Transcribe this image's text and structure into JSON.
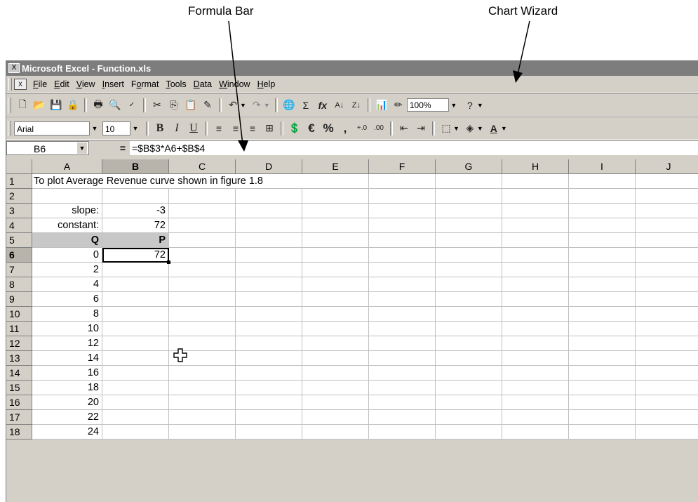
{
  "annotations": {
    "formula_bar": "Formula Bar",
    "chart_wizard": "Chart Wizard"
  },
  "window": {
    "title": "Microsoft Excel - Function.xls"
  },
  "menu": [
    {
      "label": "File"
    },
    {
      "label": "Edit"
    },
    {
      "label": "View"
    },
    {
      "label": "Insert"
    },
    {
      "label": "Format"
    },
    {
      "label": "Tools"
    },
    {
      "label": "Data"
    },
    {
      "label": "Window"
    },
    {
      "label": "Help"
    }
  ],
  "standard_toolbar": {
    "zoom": "100%",
    "icons": [
      "new-icon",
      "open-icon",
      "save-icon",
      "permission-icon",
      "print-icon",
      "print-preview-icon",
      "spelling-icon",
      "cut-icon",
      "copy-icon",
      "paste-icon",
      "format-painter-icon",
      "undo-icon",
      "redo-icon",
      "hyperlink-icon",
      "autosum-icon",
      "function-icon",
      "sort-ascending-icon",
      "sort-descending-icon",
      "chart-wizard-icon",
      "drawing-icon",
      "help-icon"
    ]
  },
  "formatting_toolbar": {
    "font": "Arial",
    "size": "10",
    "bold": "B",
    "italic": "I",
    "underline": "U",
    "currency": "€",
    "percent": "%",
    "comma": ","
  },
  "formula_bar": {
    "name_box": "B6",
    "equals": "=",
    "formula": "=$B$3*A6+$B$4"
  },
  "columns": [
    "A",
    "B",
    "C",
    "D",
    "E",
    "F",
    "G",
    "H",
    "I",
    "J"
  ],
  "rows": [
    {
      "n": "1",
      "a": "To plot Average Revenue curve shown in figure 1.8",
      "b": ""
    },
    {
      "n": "2",
      "a": "",
      "b": ""
    },
    {
      "n": "3",
      "a": "slope:",
      "b": "-3"
    },
    {
      "n": "4",
      "a": "constant:",
      "b": "72"
    },
    {
      "n": "5",
      "a": "Q",
      "b": "P"
    },
    {
      "n": "6",
      "a": "0",
      "b": "72"
    },
    {
      "n": "7",
      "a": "2",
      "b": ""
    },
    {
      "n": "8",
      "a": "4",
      "b": ""
    },
    {
      "n": "9",
      "a": "6",
      "b": ""
    },
    {
      "n": "10",
      "a": "8",
      "b": ""
    },
    {
      "n": "11",
      "a": "10",
      "b": ""
    },
    {
      "n": "12",
      "a": "12",
      "b": ""
    },
    {
      "n": "13",
      "a": "14",
      "b": ""
    },
    {
      "n": "14",
      "a": "16",
      "b": ""
    },
    {
      "n": "15",
      "a": "18",
      "b": ""
    },
    {
      "n": "16",
      "a": "20",
      "b": ""
    },
    {
      "n": "17",
      "a": "22",
      "b": ""
    },
    {
      "n": "18",
      "a": "24",
      "b": ""
    }
  ]
}
